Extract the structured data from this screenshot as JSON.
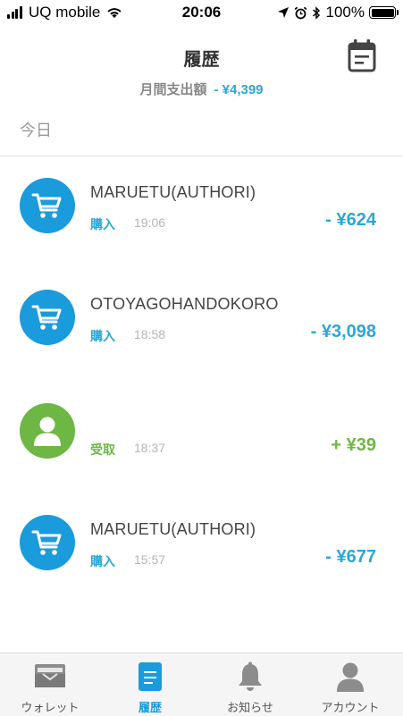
{
  "status_bar": {
    "carrier": "UQ mobile",
    "time": "20:06",
    "battery": "100%"
  },
  "header": {
    "title": "履歴",
    "summary_label": "月間支出額",
    "summary_amount": "- ¥4,399",
    "calendar_icon": "calendar-icon"
  },
  "section": {
    "label": "今日"
  },
  "transactions": [
    {
      "merchant": "MARUETU(AUTHORI)",
      "type": "購入",
      "time": "19:06",
      "amount": "- ¥624",
      "icon": "cart-icon"
    },
    {
      "merchant": "OTOYAGOHANDOKORO",
      "type": "購入",
      "time": "18:58",
      "amount": "- ¥3,098",
      "icon": "cart-icon"
    },
    {
      "merchant": "",
      "type": "受取",
      "time": "18:37",
      "amount": "+ ¥39",
      "icon": "person-icon"
    },
    {
      "merchant": "MARUETU(AUTHORI)",
      "type": "購入",
      "time": "15:57",
      "amount": "- ¥677",
      "icon": "cart-icon"
    }
  ],
  "tabbar": {
    "items": [
      {
        "label": "ウォレット",
        "icon": "wallet-icon"
      },
      {
        "label": "履歴",
        "icon": "history-icon",
        "active": true
      },
      {
        "label": "お知らせ",
        "icon": "bell-icon"
      },
      {
        "label": "アカウント",
        "icon": "account-icon"
      }
    ]
  },
  "colors": {
    "accent_blue": "#2aa7d6",
    "icon_blue": "#1a9bdc",
    "receive_green": "#6eb745",
    "muted_gray": "#b5b5b5"
  }
}
